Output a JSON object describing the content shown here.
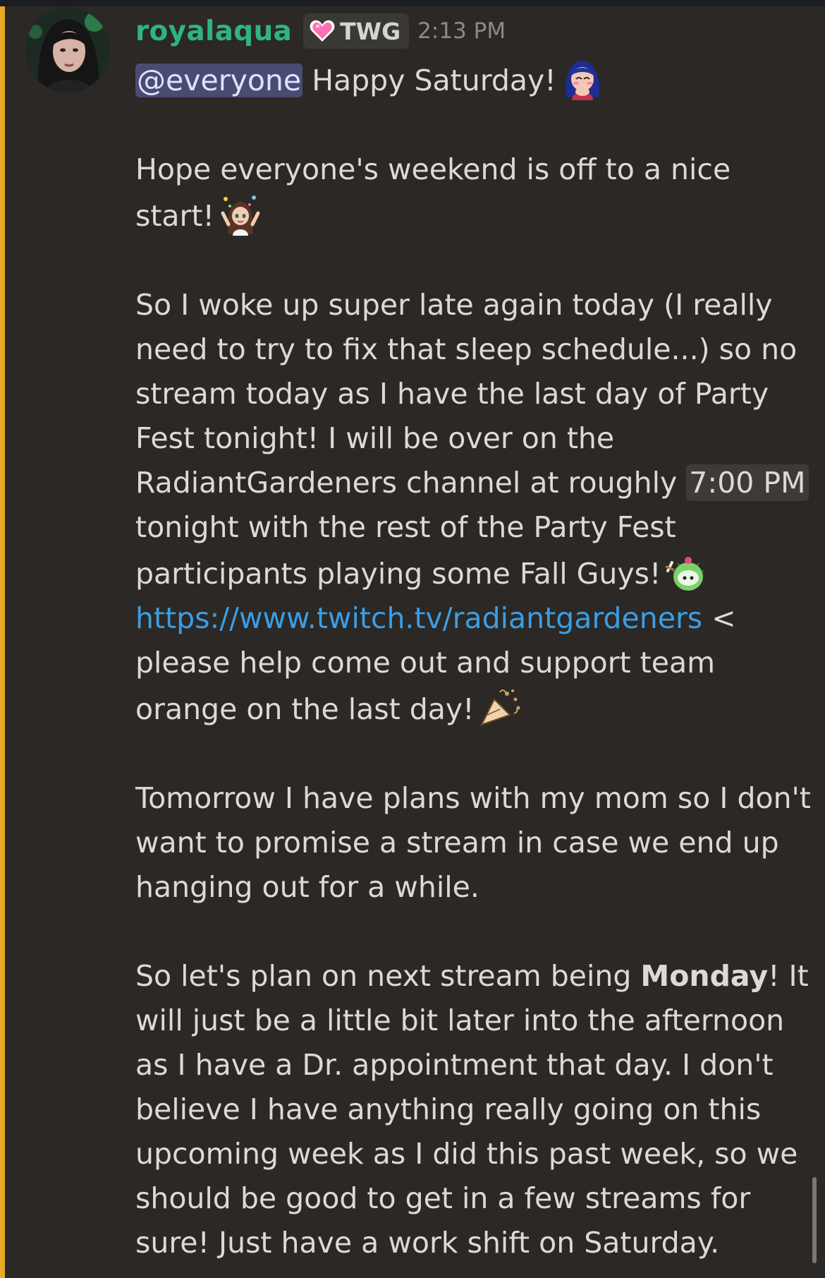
{
  "message": {
    "author": "royalaqua",
    "tag": "TWG",
    "timestamp": "2:13 PM",
    "mention": "@everyone",
    "greeting": "Happy Saturday!",
    "p2": {
      "l1": "Hope everyone's weekend is off to a nice",
      "l2": "start!"
    },
    "p3": {
      "l1": "So I woke up super late again today (I really",
      "l2": "need to try to fix that sleep schedule...) so no",
      "l3": "stream today as I have the last day of Party",
      "l4": "Fest tonight! I will be over on the",
      "l5_pre": "RadiantGardeners channel at roughly ",
      "l5_time": "7:00 PM",
      "l6": "tonight with the rest of the Party Fest",
      "l7": "participants playing some Fall Guys!",
      "l8_link": "https://www.twitch.tv/radiantgardeners",
      "l8_post": " <",
      "l9": "please help come out and support team",
      "l10": "orange on the last day!"
    },
    "p4": {
      "l1": "Tomorrow I have plans with my mom so I don't",
      "l2": "want to promise a stream in case we end up",
      "l3": "hanging out for a while."
    },
    "p5": {
      "l1_pre": "So let's plan on next stream being ",
      "l1_bold": "Monday",
      "l1_post": "! It",
      "l2": "will just be a little bit later into the afternoon",
      "l3": "as I have a Dr. appointment that day. I don't",
      "l4": "believe I have anything really going on this",
      "l5": "upcoming week as I did this past week, so we",
      "l6": "should be good to get in a few streams for",
      "l7": "sure! Just have a work shift on Saturday."
    }
  },
  "icons": {
    "avatar": "user-avatar",
    "tag": "pink-heart-icon",
    "greeting_emoji": "girl-blushing-emoji",
    "start_emoji": "cheering-girl-emoji",
    "fallguys_emoji": "fall-guys-cactus-emoji",
    "cheer_emoji": "party-popper-cheer-emoji"
  },
  "colors": {
    "username": "#2fb384",
    "mention_bg": "#4a4b72",
    "link": "#3a9ee4",
    "highlight_bar": "#e6a925",
    "background": "#2b2825"
  }
}
